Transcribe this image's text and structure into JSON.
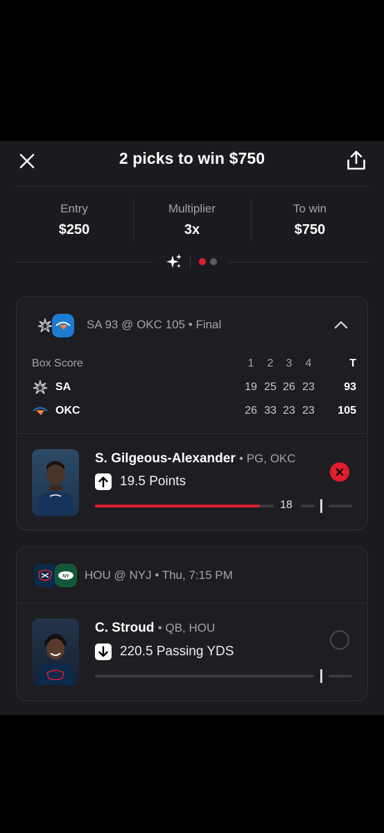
{
  "header": {
    "title": "2 picks to win $750"
  },
  "summary": {
    "entry_label": "Entry",
    "entry_value": "$250",
    "multiplier_label": "Multiplier",
    "multiplier_value": "3x",
    "towin_label": "To win",
    "towin_value": "$750"
  },
  "pager": {
    "total": 2,
    "active": 0,
    "active_color": "#e11d2e",
    "inactive_color": "#5a5a62"
  },
  "games": [
    {
      "matchup": "SA 93 @ OKC 105",
      "status": "Final",
      "box_score": {
        "label": "Box Score",
        "headers": [
          "1",
          "2",
          "3",
          "4",
          "T"
        ],
        "rows": [
          {
            "team": "SA",
            "quarters": [
              "19",
              "25",
              "26",
              "23"
            ],
            "total": "93"
          },
          {
            "team": "OKC",
            "quarters": [
              "26",
              "33",
              "23",
              "23"
            ],
            "total": "105"
          }
        ]
      },
      "pick": {
        "player": "S. Gilgeous-Alexander",
        "meta": "PG, OKC",
        "direction": "up",
        "line": "19.5 Points",
        "current_value": "18",
        "current_number": 18,
        "target_number": 19.5,
        "result": "lost"
      }
    },
    {
      "matchup": "HOU @ NYJ",
      "status": "Thu, 7:15 PM",
      "pick": {
        "player": "C. Stroud",
        "meta": "QB, HOU",
        "direction": "down",
        "line": "220.5 Passing YDS",
        "progress_fraction": 0,
        "result": "pending"
      }
    }
  ],
  "colors": {
    "loss_red": "#e11d2e",
    "okc_blue": "#1d7bd1",
    "hou_navy": "#0b2a4a",
    "nyj_green": "#13573b",
    "sheet_bg": "#1b1b1f"
  }
}
